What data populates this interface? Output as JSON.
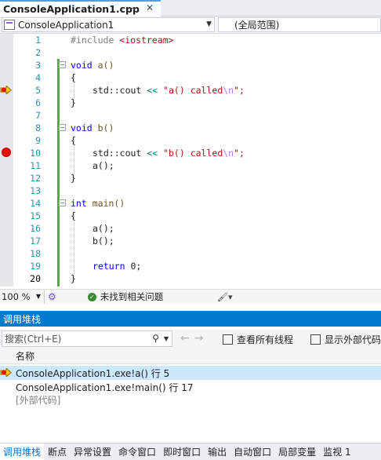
{
  "editor_tab": {
    "title": "ConsoleApplication1.cpp",
    "pin_icon": "pin-icon",
    "close_icon": "close-icon"
  },
  "navbar": {
    "project": "ConsoleApplication1",
    "scope": "(全局范围)"
  },
  "code": {
    "line_numbers": [
      "1",
      "2",
      "3",
      "4",
      "5",
      "6",
      "7",
      "8",
      "9",
      "10",
      "11",
      "12",
      "13",
      "14",
      "15",
      "16",
      "17",
      "18",
      "19",
      "20"
    ],
    "current_line": 20,
    "breakpoint_line": 10,
    "execution_arrow_line": 5,
    "tokens": {
      "l1_directive": "#include",
      "l1_header": "<iostream>",
      "kw_void": "void",
      "kw_int": "int",
      "kw_return": "return",
      "fn_a": "a()",
      "fn_b": "b()",
      "fn_main": "main()",
      "open_brace": "{",
      "close_brace": "}",
      "std": "std",
      "scope_op": "::",
      "cout": "cout",
      "shift_op": "<<",
      "str_a": "\"a() called",
      "str_b": "\"b() called",
      "escape": "\\n",
      "quote_end": "\";",
      "call_a": "a();",
      "call_b": "b();",
      "return_val": "0;"
    }
  },
  "editor_status": {
    "zoom": "100 %",
    "health_text": "未找到相关问题"
  },
  "call_stack": {
    "title": "调用堆栈",
    "search_placeholder": "搜索(Ctrl+E)",
    "show_threads": "查看所有线程",
    "show_external": "显示外部代码",
    "column_name": "名称",
    "frames": [
      "ConsoleApplication1.exe!a() 行 5",
      "ConsoleApplication1.exe!main() 行 17",
      "[外部代码]"
    ]
  },
  "bottom_tabs": [
    "调用堆栈",
    "断点",
    "异常设置",
    "命令窗口",
    "即时窗口",
    "输出",
    "自动窗口",
    "局部变量",
    "监视 1"
  ],
  "colors": {
    "accent": "#007acc",
    "breakpoint": "#e51400",
    "arrow": "#f5c518",
    "string": "#a31515",
    "keyword": "#0000ff"
  }
}
